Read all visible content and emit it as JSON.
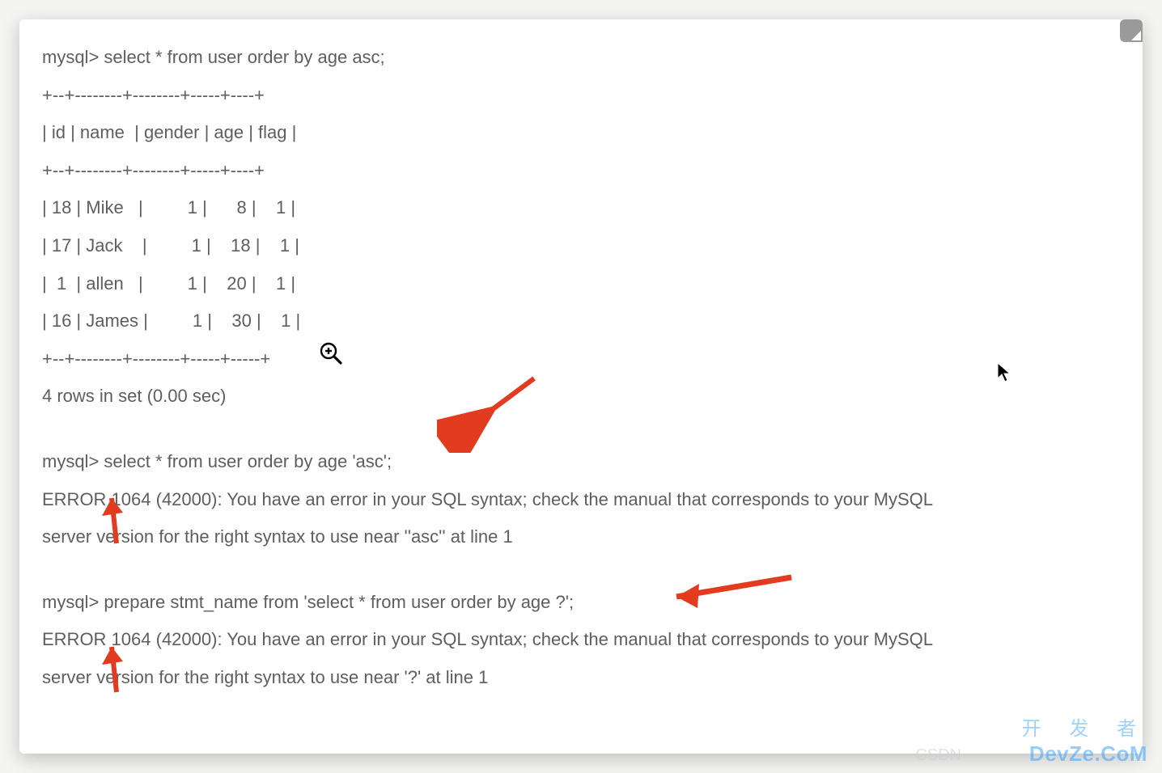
{
  "terminal": {
    "lines": {
      "q1": "mysql> select * from user order by age asc;",
      "sep1": "+--+--------+--------+-----+----+",
      "header": "| id | name  | gender | age | flag |",
      "sep2": "+--+--------+--------+-----+----+",
      "row1": "| 18 | Mike   |         1 |      8 |    1 |",
      "row2": "| 17 | Jack    |         1 |    18 |    1 |",
      "row3": "|  1  | allen   |         1 |    20 |    1 |",
      "row4": "| 16 | James |         1 |    30 |    1 |",
      "sep3": "+--+--------+--------+-----+-----+",
      "summary": "4 rows in set (0.00 sec)",
      "q2": "mysql> select * from user order by age 'asc';",
      "err2a": "ERROR 1064 (42000): You have an error in your SQL syntax; check the manual that corresponds to your MySQL",
      "err2b": "server version for the right syntax to use near ''asc'' at line 1",
      "q3": "mysql> prepare stmt_name from 'select * from user order by age ?';",
      "err3a": "ERROR 1064 (42000): You have an error in your SQL syntax; check the manual that corresponds to your MySQL",
      "err3b": "server version for the right syntax to use near '?' at line 1"
    }
  },
  "annotations": {
    "arrow1_color": "#e23b1f",
    "arrow2_color": "#e23b1f",
    "arrow3_color": "#e23b1f",
    "arrow4_color": "#e23b1f"
  },
  "watermarks": {
    "csdn": "CSDN",
    "cn": "开 发 者",
    "dev": "DevZe.CoM"
  }
}
